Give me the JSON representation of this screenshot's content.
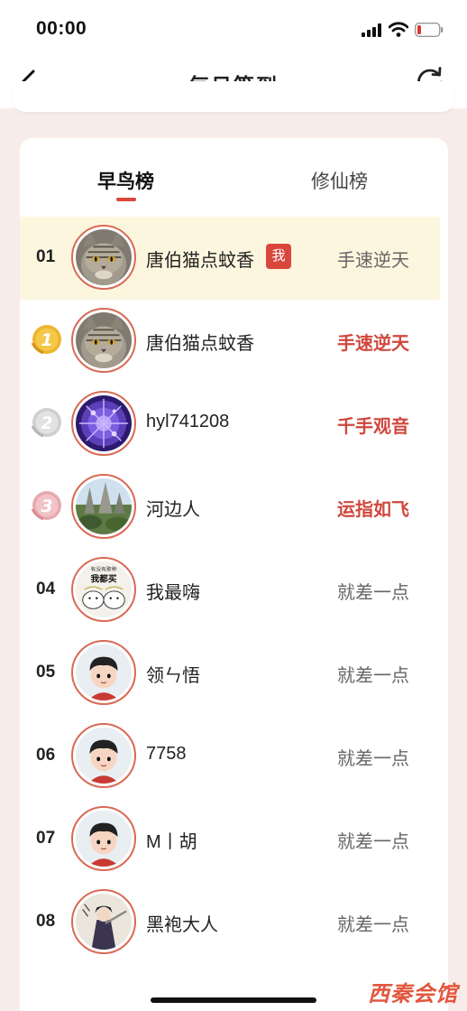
{
  "status_bar": {
    "time": "00:00"
  },
  "nav": {
    "title": "每日签到"
  },
  "tabs": [
    {
      "label": "早鸟榜",
      "active": true
    },
    {
      "label": "修仙榜",
      "active": false
    }
  ],
  "colors": {
    "accent": "#d9473c",
    "highlight_row": "#fdf6df",
    "gold": "#e6a61f",
    "silver": "#c8c8c8",
    "bronze": "#e3a3a9"
  },
  "rows": [
    {
      "rank": "01",
      "name": "唐伯猫点蚊香",
      "badge": "我",
      "status": "手速逆天",
      "status_red": false,
      "avatar": "cat"
    },
    {
      "rank": "1",
      "name": "唐伯猫点蚊香",
      "status": "手速逆天",
      "status_red": true,
      "avatar": "cat",
      "medal": "gold"
    },
    {
      "rank": "2",
      "name": "hyl741208",
      "status": "千手观音",
      "status_red": true,
      "avatar": "purple",
      "medal": "silver"
    },
    {
      "rank": "3",
      "name": "河边人",
      "status": "运指如飞",
      "status_red": true,
      "avatar": "landscape",
      "medal": "bronze"
    },
    {
      "rank": "04",
      "name": "我最嗨",
      "status": "就差一点",
      "status_red": false,
      "avatar": "meme",
      "avatar_text_top": "有没有那种",
      "avatar_text_main": "我都买"
    },
    {
      "rank": "05",
      "name": "领ㄣ悟",
      "status": "就差一点",
      "status_red": false,
      "avatar": "cartoon"
    },
    {
      "rank": "06",
      "name": "7758",
      "status": "就差一点",
      "status_red": false,
      "avatar": "cartoon"
    },
    {
      "rank": "07",
      "name": "M丨胡",
      "status": "就差一点",
      "status_red": false,
      "avatar": "cartoon"
    },
    {
      "rank": "08",
      "name": "黑袍大人",
      "status": "就差一点",
      "status_red": false,
      "avatar": "character"
    }
  ],
  "watermark": "西秦会馆"
}
